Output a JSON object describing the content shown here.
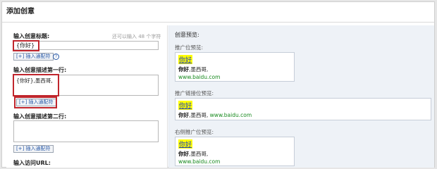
{
  "page": {
    "title": "添加创意"
  },
  "form": {
    "headline": {
      "label": "输入创意标题:",
      "hint": "还可以输入 48 个字符",
      "value": "{你好}",
      "insert_label": "[+] 插入通配符",
      "help": "?"
    },
    "desc1": {
      "label": "输入创意描述第一行:",
      "value": "{你好},墨西哥,",
      "insert_label": "[+] 插入通配符"
    },
    "desc2": {
      "label": "输入创意描述第二行:",
      "value": "",
      "insert_label": "[+] 插入通配符"
    },
    "url": {
      "label": "输入访问URL:"
    }
  },
  "preview": {
    "heading": "创意预览:",
    "sections": [
      {
        "label": "推广位预览:",
        "title": "你好",
        "desc_bold": "你好",
        "desc_rest": ",墨西哥,",
        "url": "www.baidu.com"
      },
      {
        "label": "推广链接位预览:",
        "title": "你好",
        "desc_bold": "你好",
        "desc_rest": ",墨西哥,",
        "url": "www.baidu.com"
      },
      {
        "label": "右侧推广位预览:",
        "title": "你好",
        "desc_bold": "你好",
        "desc_rest": ",墨西哥,",
        "url": "www.baidu.com"
      }
    ]
  },
  "colors": {
    "highlight_box": "#c0262d",
    "title_highlight": "#ffff00",
    "link": "#1a3dc1",
    "url": "#188a1f"
  }
}
